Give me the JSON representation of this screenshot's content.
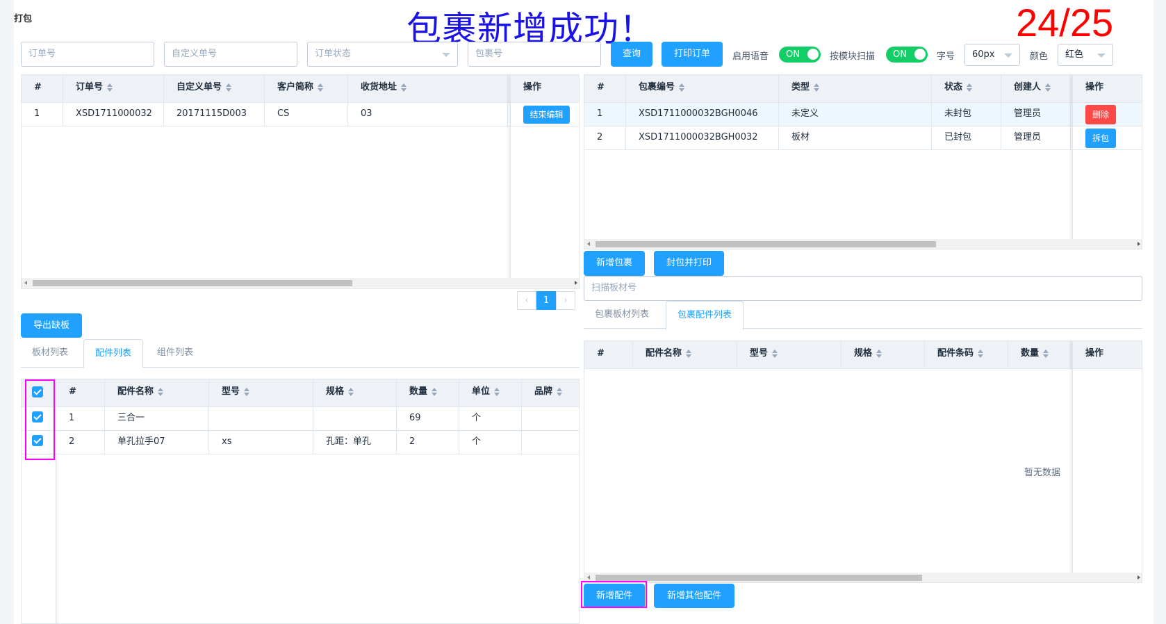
{
  "page": {
    "title": "打包"
  },
  "overlay": {
    "banner": "包裹新增成功！",
    "counter": "24/25"
  },
  "toolbar": {
    "order_no_placeholder": "订单号",
    "custom_no_placeholder": "自定义单号",
    "order_status_placeholder": "订单状态",
    "package_no_placeholder": "包裹号",
    "query": "查询",
    "print_order": "打印订单",
    "voice_label": "启用语音",
    "voice_state": "ON",
    "module_scan_label": "按模块扫描",
    "module_scan_state": "ON",
    "font_size_label": "字号",
    "font_size_value": "60px",
    "color_label": "颜色",
    "color_value": "红色"
  },
  "orders_table": {
    "columns": [
      "#",
      "订单号",
      "自定义单号",
      "客户简称",
      "收货地址",
      "操作"
    ],
    "rows": [
      {
        "idx": "1",
        "order_no": "XSD1711000032",
        "custom_no": "20171115D003",
        "customer": "CS",
        "address": "03",
        "action": "结束编辑"
      }
    ],
    "page": "1"
  },
  "packages_table": {
    "columns": [
      "#",
      "包裹编号",
      "类型",
      "状态",
      "创建人",
      "操作"
    ],
    "rows": [
      {
        "idx": "1",
        "pkg_no": "XSD1711000032BGH0046",
        "type": "未定义",
        "status": "未封包",
        "creator": "管理员",
        "action": "删除"
      },
      {
        "idx": "2",
        "pkg_no": "XSD1711000032BGH0032",
        "type": "板材",
        "status": "已封包",
        "creator": "管理员",
        "action": "拆包"
      }
    ]
  },
  "package_actions": {
    "add_package": "新增包裹",
    "seal_print": "封包并打印",
    "scan_placeholder": "扫描板材号"
  },
  "package_tabs": [
    "包裹板材列表",
    "包裹配件列表"
  ],
  "package_parts_table": {
    "columns": [
      "#",
      "配件名称",
      "型号",
      "规格",
      "配件条码",
      "数量",
      "操作"
    ],
    "empty": "暂无数据"
  },
  "package_part_buttons": {
    "add_part": "新增配件",
    "add_other_part": "新增其他配件"
  },
  "export_button": "导出缺板",
  "left_tabs": [
    "板材列表",
    "配件列表",
    "组件列表"
  ],
  "parts_table": {
    "columns": [
      "#",
      "配件名称",
      "型号",
      "规格",
      "数量",
      "单位",
      "品牌"
    ],
    "rows": [
      {
        "idx": "1",
        "name": "三合一",
        "model": "",
        "spec": "",
        "qty": "69",
        "unit": "个",
        "brand": ""
      },
      {
        "idx": "2",
        "name": "单孔拉手07",
        "model": "xs",
        "spec": "孔距：单孔",
        "qty": "2",
        "unit": "个",
        "brand": ""
      }
    ]
  }
}
